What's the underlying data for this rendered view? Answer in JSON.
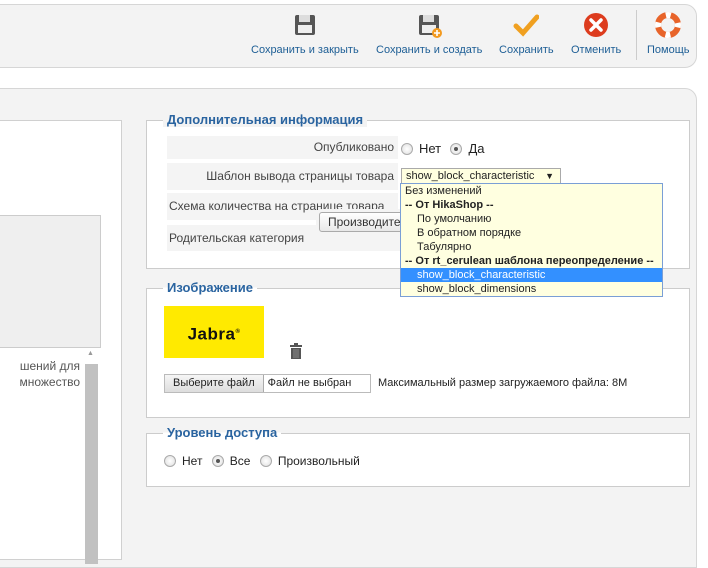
{
  "toolbar": {
    "save_close": "Сохранить и закрыть",
    "save_new": "Сохранить и создать",
    "save": "Сохранить",
    "cancel": "Отменить",
    "help": "Помощь"
  },
  "left": {
    "text_line1": "шений для",
    "text_line2": "множество"
  },
  "additional": {
    "legend": "Дополнительная информация",
    "published_label": "Опубликовано",
    "published_no": "Нет",
    "published_yes": "Да",
    "published_value": "Да",
    "template_label": "Шаблон вывода страницы товара",
    "template_value": "show_block_characteristic",
    "quantity_label": "Схема количества на странице товара",
    "parent_label": "Родительская категория",
    "parent_value": "Производители",
    "options": [
      {
        "label": "Без изменений",
        "type": "plain"
      },
      {
        "label": "-- От HikaShop --",
        "type": "group"
      },
      {
        "label": "По умолчанию",
        "type": "item"
      },
      {
        "label": "В обратном порядке",
        "type": "item"
      },
      {
        "label": "Табулярно",
        "type": "item"
      },
      {
        "label": "-- От rt_cerulean шаблона переопределение --",
        "type": "group"
      },
      {
        "label": "show_block_characteristic",
        "type": "selected"
      },
      {
        "label": "show_block_dimensions",
        "type": "item"
      }
    ]
  },
  "image": {
    "legend": "Изображение",
    "logo_text": "Jabra",
    "choose_file": "Выберите файл",
    "no_file": "Файл не выбран",
    "max_size": "Максимальный размер загружаемого файла: 8M"
  },
  "access": {
    "legend": "Уровень доступа",
    "none": "Нет",
    "all": "Все",
    "custom": "Произвольный",
    "value": "Все"
  },
  "colors": {
    "link": "#1d5e95",
    "legend": "#2a64a0",
    "highlight": "#3390ff",
    "logo_bg": "#ffea00"
  }
}
